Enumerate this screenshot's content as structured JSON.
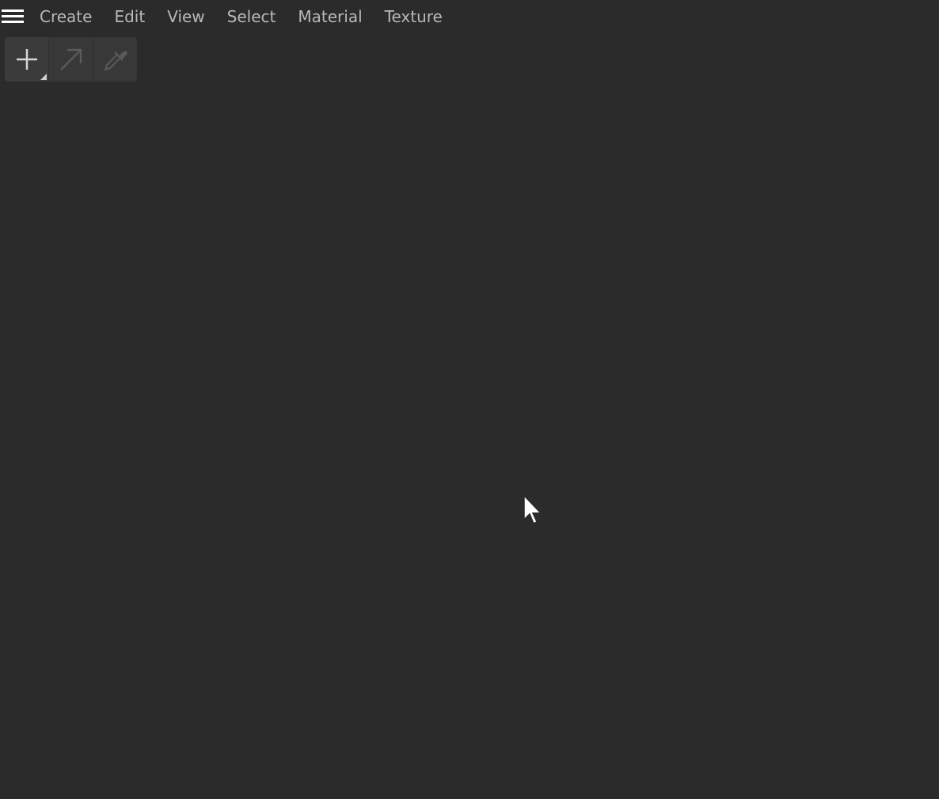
{
  "menu": {
    "hamburger_icon": "hamburger-menu-icon",
    "items": [
      {
        "label": "Create"
      },
      {
        "label": "Edit"
      },
      {
        "label": "View"
      },
      {
        "label": "Select"
      },
      {
        "label": "Material"
      },
      {
        "label": "Texture"
      }
    ]
  },
  "toolbar": {
    "buttons": [
      {
        "icon": "plus-icon",
        "has_submenu": true,
        "enabled": true
      },
      {
        "icon": "arrow-up-right-icon",
        "enabled": false
      },
      {
        "icon": "eyedropper-icon",
        "enabled": false
      }
    ]
  },
  "colors": {
    "background": "#2b2b2b",
    "menu_text": "#b8b8b8",
    "toolbar_bg": "#383838",
    "icon_enabled": "#d6d6d6",
    "icon_disabled": "#5a5a5a"
  }
}
